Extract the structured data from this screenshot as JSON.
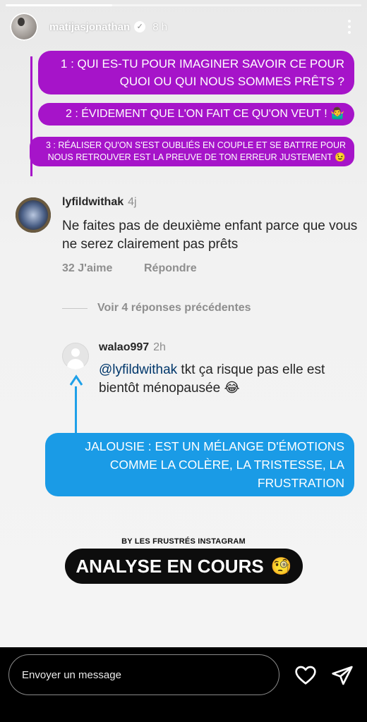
{
  "header": {
    "username": "matijasjonathan",
    "verified_mark": "✓",
    "time": "8 h"
  },
  "progress": {
    "fraction": 0.3
  },
  "annotations": {
    "purple_1": "1 : QUI ES-TU POUR IMAGINER SAVOIR CE POUR QUOI OU QUI NOUS SOMMES PRÊTS ?",
    "purple_2": "2 : ÉVIDEMENT QUE L'ON FAIT CE QU'ON VEUT ! 🤷‍♂️",
    "purple_3": "3 : RÉALISER QU'ON S'EST OUBLIÉS EN COUPLE ET SE BATTRE POUR NOUS RETROUVER EST LA PREUVE DE TON ERREUR JUSTEMENT 😉",
    "blue_1": "JALOUSIE : EST UN MÉLANGE D'ÉMOTIONS COMME LA COLÈRE, LA TRISTESSE, LA FRUSTRATION"
  },
  "comment": {
    "username": "lyfildwithak",
    "time": "4j",
    "text": "Ne faites pas de deuxième enfant parce que vous ne serez clairement pas prêts",
    "likes": "32 J'aime",
    "reply": "Répondre"
  },
  "previous_replies": "Voir 4 réponses précédentes",
  "reply_comment": {
    "username": "walao997",
    "time": "2h",
    "mention": "@lyfildwithak",
    "text": " tkt ça risque pas elle est bientôt ménopausée 😂"
  },
  "credit": "BY LES FRUSTRÉS INSTAGRAM",
  "analyse": {
    "label": "ANALYSE EN COURS",
    "emoji": "🧐"
  },
  "footer": {
    "message_placeholder": "Envoyer un message"
  },
  "colors": {
    "purple": "#a614c9",
    "blue": "#1a9be6",
    "footer_bg": "#000000"
  },
  "icons": {
    "heart": "heart-icon",
    "send": "send-icon",
    "more": "more-icon"
  }
}
